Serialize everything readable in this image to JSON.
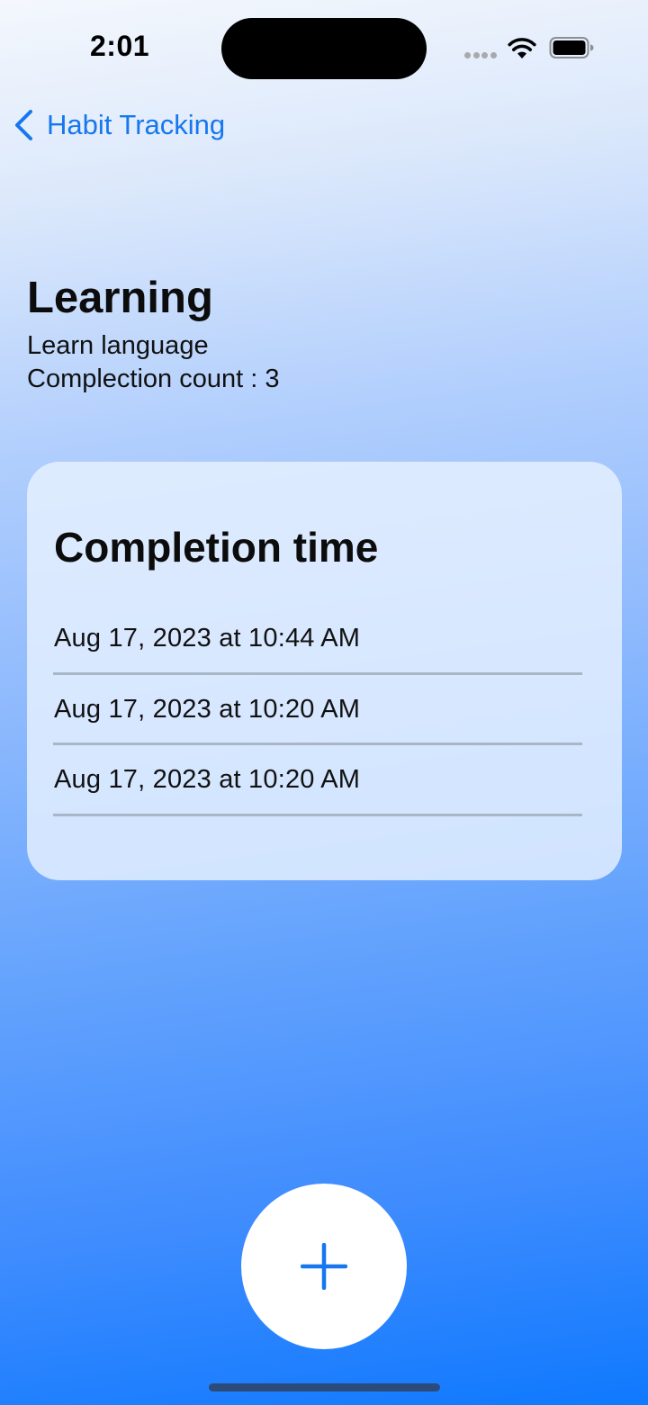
{
  "status_bar": {
    "time": "2:01",
    "icons": [
      "cellular-signal-icon",
      "wifi-icon",
      "battery-icon"
    ]
  },
  "navigation": {
    "back_label": "Habit Tracking",
    "back_icon": "chevron-left-icon"
  },
  "habit": {
    "title": "Learning",
    "subtitle": "Learn language",
    "completion_count_text": "Complection count : 3"
  },
  "completion_card": {
    "title": "Completion time",
    "entries": [
      "Aug 17, 2023 at 10:44 AM",
      "Aug 17, 2023 at 10:20 AM",
      "Aug 17, 2023 at 10:20 AM"
    ]
  },
  "add_button": {
    "icon": "plus-icon"
  },
  "colors": {
    "accent": "#1677ee",
    "gradient_top": "#f4f7fd",
    "gradient_bottom": "#0f79fe",
    "card_background": "#e8f2ff",
    "divider": "#a9b6c5"
  }
}
